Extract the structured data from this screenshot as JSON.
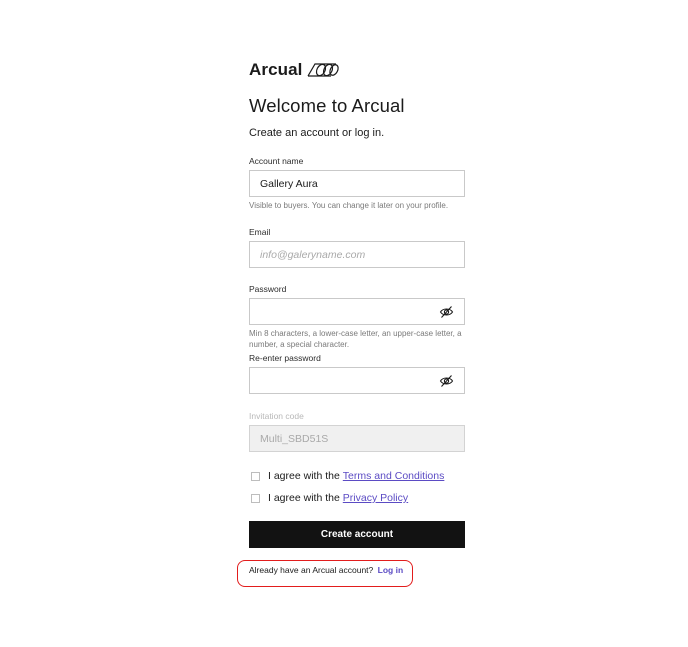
{
  "brand": {
    "name": "Arcual",
    "logo_icon": "arcual-mark-icon"
  },
  "heading": {
    "title": "Welcome to Arcual",
    "subtitle": "Create an account or log in."
  },
  "fields": {
    "account_name": {
      "label": "Account name",
      "value": "Gallery Aura",
      "hint": "Visible to buyers. You can change it later on your profile."
    },
    "email": {
      "label": "Email",
      "value": "",
      "placeholder": "info@galeryname.com"
    },
    "password": {
      "label": "Password",
      "value": "",
      "hint": "Min 8 characters, a lower-case letter, an upper-case letter, a number, a special character.",
      "toggle_icon": "eye-off-icon"
    },
    "reenter_password": {
      "label": "Re-enter password",
      "value": "",
      "toggle_icon": "eye-off-icon"
    },
    "invitation_code": {
      "label": "Invitation code",
      "value": "Multi_SBD51S",
      "disabled": true
    }
  },
  "agreements": [
    {
      "prefix": "I agree with the",
      "link": "Terms and Conditions",
      "checked": false
    },
    {
      "prefix": "I agree with the",
      "link": "Privacy Policy",
      "checked": false
    }
  ],
  "submit": {
    "label": "Create account"
  },
  "login": {
    "prompt": "Already have an Arcual account?",
    "link": "Log in"
  },
  "colors": {
    "link": "#5b4bc4",
    "button_bg": "#121212",
    "highlight": "#e21d1d"
  }
}
